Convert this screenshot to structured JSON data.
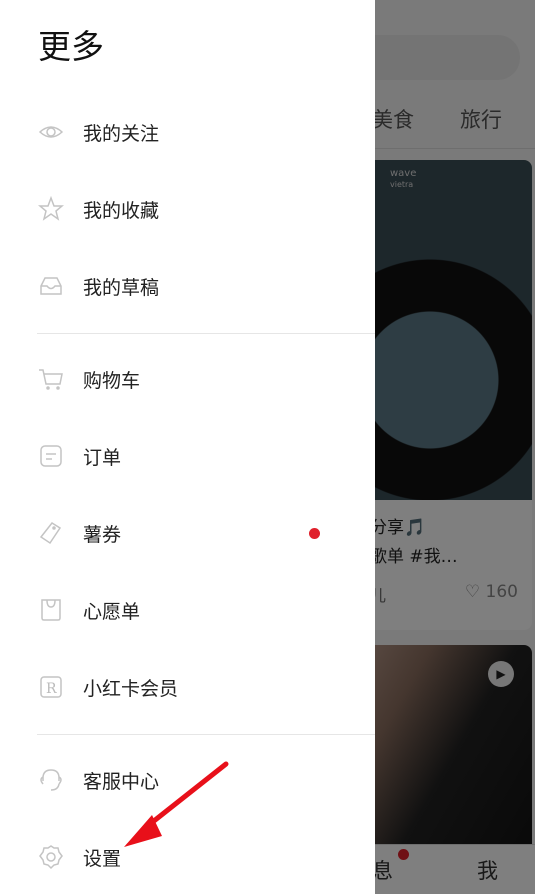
{
  "drawer": {
    "title": "更多",
    "groups": [
      [
        {
          "label": "我的关注",
          "icon": "eye-icon"
        },
        {
          "label": "我的收藏",
          "icon": "star-icon"
        },
        {
          "label": "我的草稿",
          "icon": "inbox-icon"
        }
      ],
      [
        {
          "label": "购物车",
          "icon": "cart-icon"
        },
        {
          "label": "订单",
          "icon": "order-icon"
        },
        {
          "label": "薯券",
          "icon": "coupon-icon",
          "badge": true
        },
        {
          "label": "心愿单",
          "icon": "bag-icon"
        },
        {
          "label": "小红卡会员",
          "icon": "r-card-icon"
        }
      ],
      [
        {
          "label": "客服中心",
          "icon": "headset-icon"
        },
        {
          "label": "设置",
          "icon": "gear-icon"
        }
      ]
    ],
    "badge_color": "#e0202b"
  },
  "background": {
    "tabs": [
      "美食",
      "旅行"
    ],
    "card1": {
      "image_text": "wave",
      "image_subtext": "vietra",
      "title_line1": "分享🎵",
      "title_line2": "歌单 #我…",
      "author": "儿",
      "likes": "160"
    },
    "bottom_nav": [
      "息",
      "我"
    ]
  },
  "annotation": {
    "arrow_color": "#e8101a"
  }
}
